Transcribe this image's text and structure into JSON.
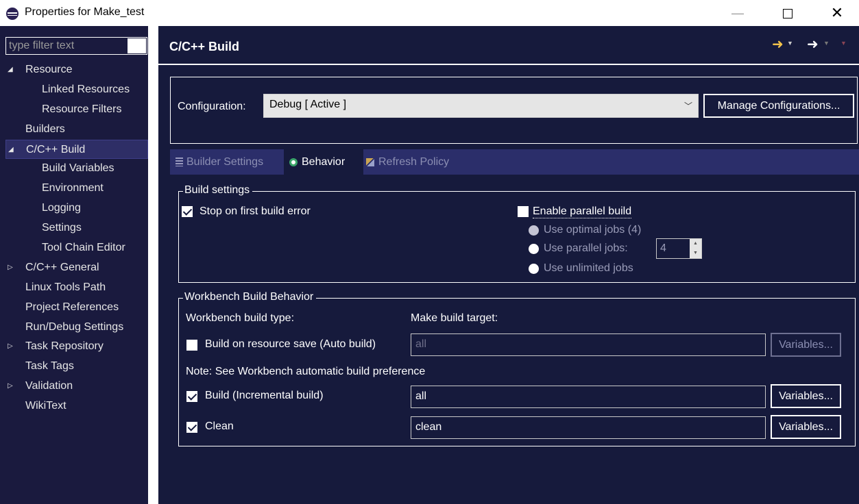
{
  "window": {
    "title": "Properties for Make_test",
    "minimize_glyph": "—",
    "close_glyph": "✕"
  },
  "sidebar": {
    "filter_placeholder": "type filter text",
    "items": [
      {
        "label": "Resource",
        "expanded": true,
        "depth": 0
      },
      {
        "label": "Linked Resources",
        "depth": 1
      },
      {
        "label": "Resource Filters",
        "depth": 1
      },
      {
        "label": "Builders",
        "depth": 0
      },
      {
        "label": "C/C++ Build",
        "expanded": true,
        "depth": 0,
        "selected": true
      },
      {
        "label": "Build Variables",
        "depth": 1
      },
      {
        "label": "Environment",
        "depth": 1
      },
      {
        "label": "Logging",
        "depth": 1
      },
      {
        "label": "Settings",
        "depth": 1
      },
      {
        "label": "Tool Chain Editor",
        "depth": 1
      },
      {
        "label": "C/C++ General",
        "expanded": false,
        "depth": 0
      },
      {
        "label": "Linux Tools Path",
        "depth": 0
      },
      {
        "label": "Project References",
        "depth": 0
      },
      {
        "label": "Run/Debug Settings",
        "depth": 0
      },
      {
        "label": "Task Repository",
        "expanded": false,
        "depth": 0
      },
      {
        "label": "Task Tags",
        "depth": 0
      },
      {
        "label": "Validation",
        "expanded": false,
        "depth": 0
      },
      {
        "label": "WikiText",
        "depth": 0
      }
    ]
  },
  "page": {
    "title": "C/C++ Build",
    "configuration_label": "Configuration:",
    "configuration_value": "Debug  [ Active ]",
    "manage_label": "Manage Configurations...",
    "tabs": [
      {
        "label": "Builder Settings",
        "active": false
      },
      {
        "label": "Behavior",
        "active": true
      },
      {
        "label": "Refresh Policy",
        "active": false
      }
    ]
  },
  "build_settings": {
    "legend": "Build settings",
    "stop_on_error": {
      "label": "Stop on first build error",
      "checked": true
    },
    "parallel": {
      "label": "Enable parallel build",
      "checked": false
    },
    "optimal_jobs": "Use optimal jobs (4)",
    "parallel_jobs": "Use parallel jobs:",
    "parallel_jobs_value": "4",
    "unlimited_jobs": "Use unlimited jobs"
  },
  "workbench": {
    "legend": "Workbench Build Behavior",
    "build_type_label": "Workbench build type:",
    "target_label": "Make build target:",
    "note": "Note: See Workbench automatic build preference",
    "variables_label": "Variables...",
    "auto": {
      "label": "Build on resource save (Auto build)",
      "checked": false,
      "target": "all"
    },
    "incremental": {
      "label": "Build (Incremental build)",
      "checked": true,
      "target": "all"
    },
    "clean": {
      "label": "Clean",
      "checked": true,
      "target": "clean"
    }
  },
  "colors": {
    "panel_bg": "#161a3c",
    "sidebar_bg": "#1a1a3e",
    "tabbar_bg": "#2b2e6a",
    "selection_bg": "#2e2e66",
    "back_arrow": "#f2c24b"
  }
}
